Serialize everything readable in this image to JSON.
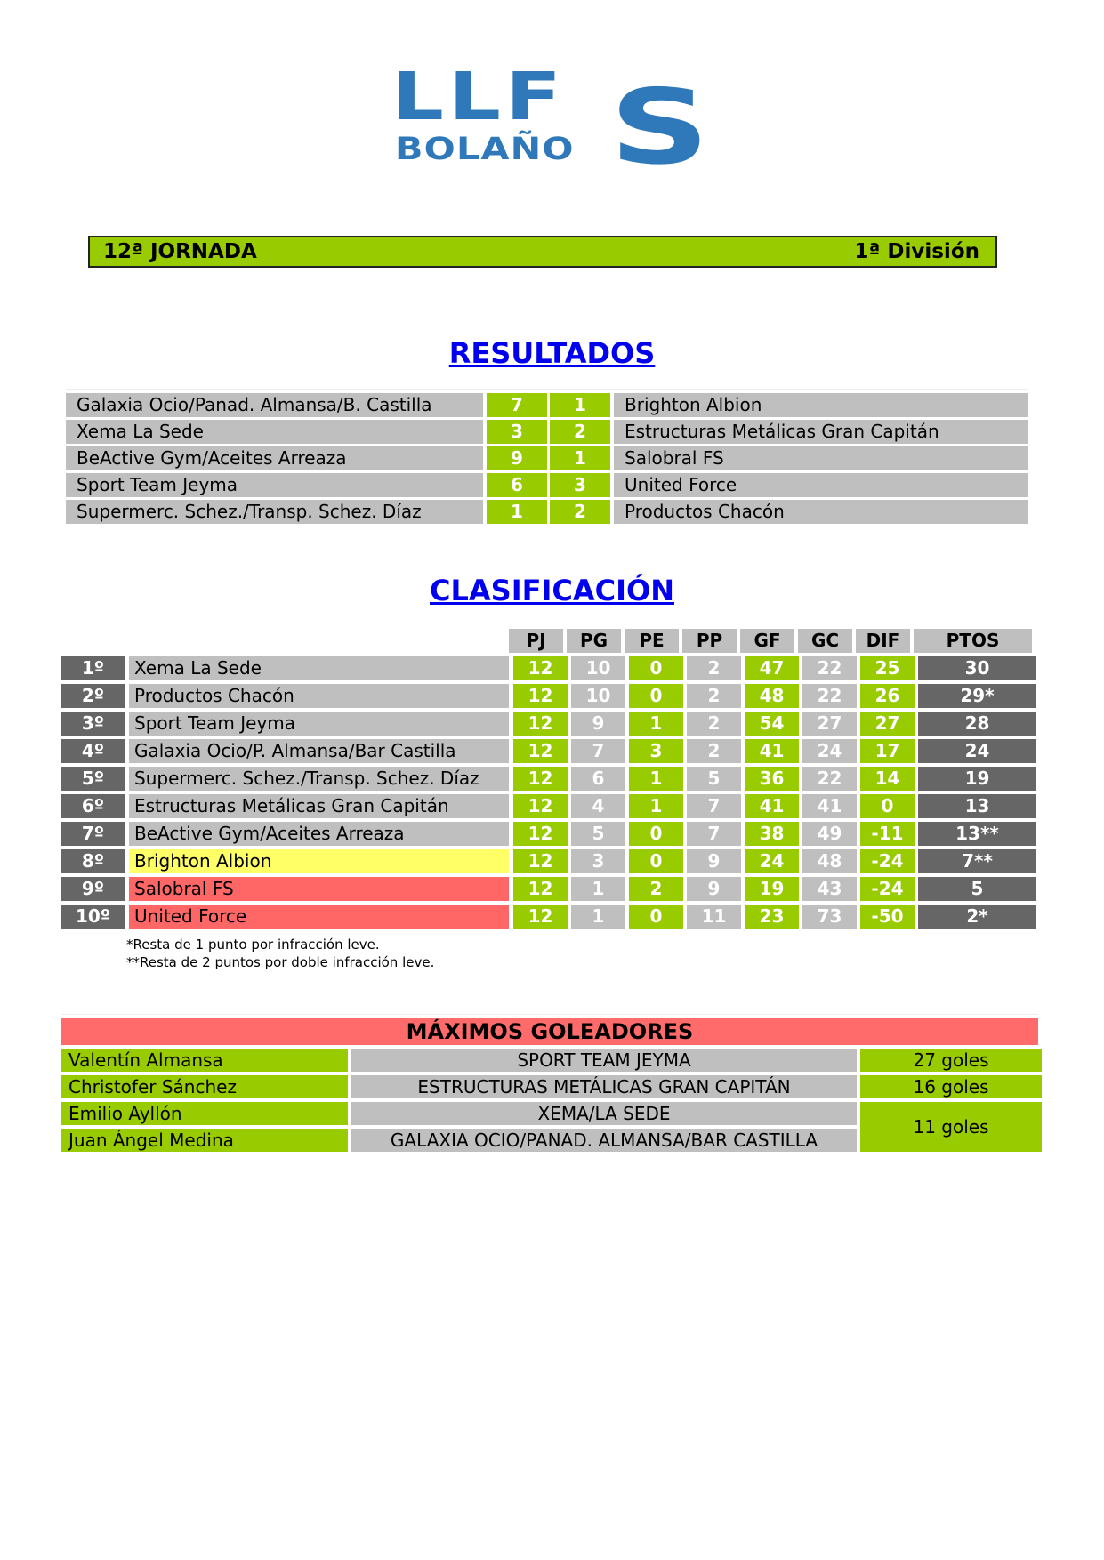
{
  "logo": {
    "line1": "LLF",
    "line2": "BOLAÑO",
    "big_letter": "S",
    "color": "#2f78b9"
  },
  "header": {
    "jornada": "12ª JORNADA",
    "division": "1ª División"
  },
  "results": {
    "title": "RESULTADOS",
    "matches": [
      {
        "home": "Galaxia Ocio/Panad. Almansa/B. Castilla",
        "home_score": "7",
        "away_score": "1",
        "away": "Brighton Albion"
      },
      {
        "home": "Xema La Sede",
        "home_score": "3",
        "away_score": "2",
        "away": "Estructuras Metálicas Gran Capitán"
      },
      {
        "home": "BeActive Gym/Aceites Arreaza",
        "home_score": "9",
        "away_score": "1",
        "away": "Salobral FS"
      },
      {
        "home": "Sport Team Jeyma",
        "home_score": "6",
        "away_score": "3",
        "away": "United Force"
      },
      {
        "home": "Supermerc. Schez./Transp. Schez. Díaz",
        "home_score": "1",
        "away_score": "2",
        "away": "Productos Chacón"
      }
    ]
  },
  "standings": {
    "title": "CLASIFICACIÓN",
    "columns": [
      "PJ",
      "PG",
      "PE",
      "PP",
      "GF",
      "GC",
      "DIF",
      "PTOS"
    ],
    "rows": [
      {
        "pos": "1º",
        "team": "Xema La Sede",
        "pj": "12",
        "pg": "10",
        "pe": "0",
        "pp": "2",
        "gf": "47",
        "gc": "22",
        "dif": "25",
        "pts": "30",
        "highlight": "none"
      },
      {
        "pos": "2º",
        "team": "Productos Chacón",
        "pj": "12",
        "pg": "10",
        "pe": "0",
        "pp": "2",
        "gf": "48",
        "gc": "22",
        "dif": "26",
        "pts": "29*",
        "highlight": "none"
      },
      {
        "pos": "3º",
        "team": "Sport Team Jeyma",
        "pj": "12",
        "pg": "9",
        "pe": "1",
        "pp": "2",
        "gf": "54",
        "gc": "27",
        "dif": "27",
        "pts": "28",
        "highlight": "none"
      },
      {
        "pos": "4º",
        "team": "Galaxia Ocio/P. Almansa/Bar Castilla",
        "pj": "12",
        "pg": "7",
        "pe": "3",
        "pp": "2",
        "gf": "41",
        "gc": "24",
        "dif": "17",
        "pts": "24",
        "highlight": "none"
      },
      {
        "pos": "5º",
        "team": "Supermerc. Schez./Transp. Schez. Díaz",
        "pj": "12",
        "pg": "6",
        "pe": "1",
        "pp": "5",
        "gf": "36",
        "gc": "22",
        "dif": "14",
        "pts": "19",
        "highlight": "none"
      },
      {
        "pos": "6º",
        "team": "Estructuras Metálicas Gran Capitán",
        "pj": "12",
        "pg": "4",
        "pe": "1",
        "pp": "7",
        "gf": "41",
        "gc": "41",
        "dif": "0",
        "pts": "13",
        "highlight": "none"
      },
      {
        "pos": "7º",
        "team": "BeActive Gym/Aceites Arreaza",
        "pj": "12",
        "pg": "5",
        "pe": "0",
        "pp": "7",
        "gf": "38",
        "gc": "49",
        "dif": "-11",
        "pts": "13**",
        "highlight": "none"
      },
      {
        "pos": "8º",
        "team": "Brighton Albion",
        "pj": "12",
        "pg": "3",
        "pe": "0",
        "pp": "9",
        "gf": "24",
        "gc": "48",
        "dif": "-24",
        "pts": "7**",
        "highlight": "yellow"
      },
      {
        "pos": "9º",
        "team": "Salobral FS",
        "pj": "12",
        "pg": "1",
        "pe": "2",
        "pp": "9",
        "gf": "19",
        "gc": "43",
        "dif": "-24",
        "pts": "5",
        "highlight": "red"
      },
      {
        "pos": "10º",
        "team": "United Force",
        "pj": "12",
        "pg": "1",
        "pe": "0",
        "pp": "11",
        "gf": "23",
        "gc": "73",
        "dif": "-50",
        "pts": "2*",
        "highlight": "red"
      }
    ],
    "notes": [
      "*Resta de 1 punto por infracción leve.",
      "**Resta de 2 puntos por doble infracción leve."
    ]
  },
  "scorers": {
    "title": "MÁXIMOS GOLEADORES",
    "rows": [
      {
        "player": "Valentín Almansa",
        "team": "SPORT TEAM JEYMA",
        "goals": "27 goles"
      },
      {
        "player": "Christofer Sánchez",
        "team": "ESTRUCTURAS METÁLICAS GRAN CAPITÁN",
        "goals": "16 goles"
      },
      {
        "player": "Emilio Ayllón",
        "team": "XEMA/LA SEDE",
        "goals": "11 goles"
      },
      {
        "player": "Juan Ángel Medina",
        "team": "GALAXIA OCIO/PANAD. ALMANSA/BAR CASTILLA",
        "goals": "11 goles"
      }
    ]
  },
  "colors": {
    "green": "#99cc00",
    "grey": "#bfbfbf",
    "dark": "#666666",
    "yellow": "#ffff66",
    "red": "#ff6666",
    "title_blue": "#0000ee"
  }
}
